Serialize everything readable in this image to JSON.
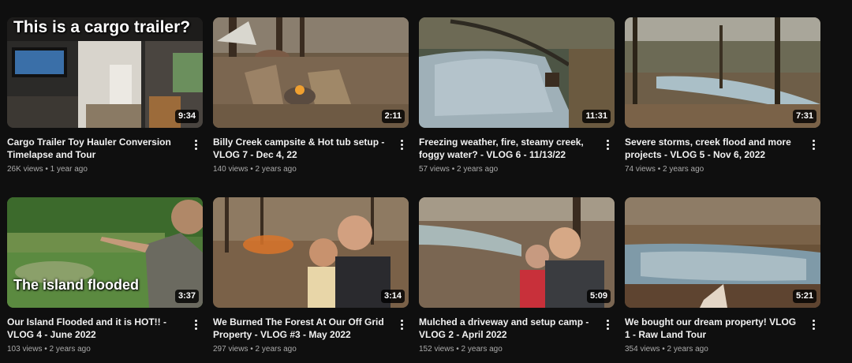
{
  "videos": [
    {
      "title": "Cargo Trailer Toy Hauler Conversion Timelapse and Tour",
      "views": "26K views",
      "age": "1 year ago",
      "duration": "9:34",
      "overlay": "This is a cargo trailer?"
    },
    {
      "title": "Billy Creek campsite & Hot tub setup - VLOG 7 - Dec 4, 22",
      "views": "140 views",
      "age": "2 years ago",
      "duration": "2:11"
    },
    {
      "title": "Freezing weather, fire, steamy creek, foggy water? - VLOG 6 - 11/13/22",
      "views": "57 views",
      "age": "2 years ago",
      "duration": "11:31"
    },
    {
      "title": "Severe storms, creek flood and more projects - VLOG 5 - Nov 6, 2022",
      "views": "74 views",
      "age": "2 years ago",
      "duration": "7:31"
    },
    {
      "title": "Our Island Flooded and it is HOT!! - VLOG 4 - June 2022",
      "views": "103 views",
      "age": "2 years ago",
      "duration": "3:37",
      "overlay": "The island flooded"
    },
    {
      "title": "We Burned The Forest At Our Off Grid Property - VLOG #3 - May 2022",
      "views": "297 views",
      "age": "2 years ago",
      "duration": "3:14"
    },
    {
      "title": "Mulched a driveway and setup camp - VLOG 2 - April 2022",
      "views": "152 views",
      "age": "2 years ago",
      "duration": "5:09"
    },
    {
      "title": "We bought our dream property! VLOG 1 - Raw Land Tour",
      "views": "354 views",
      "age": "2 years ago",
      "duration": "5:21"
    }
  ],
  "separator": "•",
  "icons": {
    "menu": "more-vert-icon"
  }
}
